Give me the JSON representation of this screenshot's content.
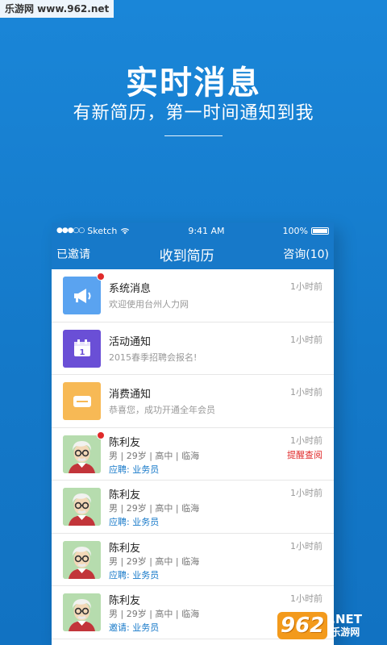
{
  "watermark": {
    "top_left": "乐游网 www.962.net",
    "logo": "962",
    "site": ".NET",
    "site_cn": "乐游网"
  },
  "hero": {
    "title": "实时消息",
    "subtitle": "有新简历，第一时间通知到我"
  },
  "status_bar": {
    "carrier": "Sketch",
    "time": "9:41 AM",
    "battery": "100%"
  },
  "nav": {
    "left": "已邀请",
    "title": "收到简历",
    "right": "咨询(10)"
  },
  "messages": [
    {
      "title": "系统消息",
      "subtitle": "欢迎使用台州人力网",
      "time": "1小时前",
      "icon": "megaphone-icon",
      "color": "#5aa3f0",
      "unread": true
    },
    {
      "title": "活动通知",
      "subtitle": "2015春季招聘会报名!",
      "time": "1小时前",
      "icon": "calendar-icon",
      "color": "#6a4fd6",
      "unread": false
    },
    {
      "title": "消费通知",
      "subtitle": "恭喜您，成功开通全年会员",
      "time": "1小时前",
      "icon": "wallet-icon",
      "color": "#f7b955",
      "unread": false
    }
  ],
  "resumes": [
    {
      "name": "陈利友",
      "info": "男 | 29岁 | 高中 | 临海",
      "job_label": "应聘:",
      "job": "业务员",
      "time": "1小时前",
      "action": "提醒查阅",
      "unread": true
    },
    {
      "name": "陈利友",
      "info": "男 | 29岁 | 高中 | 临海",
      "job_label": "应聘:",
      "job": "业务员",
      "time": "1小时前",
      "action": "",
      "unread": false
    },
    {
      "name": "陈利友",
      "info": "男 | 29岁 | 高中 | 临海",
      "job_label": "应聘:",
      "job": "业务员",
      "time": "1小时前",
      "action": "",
      "unread": false
    },
    {
      "name": "陈利友",
      "info": "男 | 29岁 | 高中 | 临海",
      "job_label": "邀请:",
      "job": "业务员",
      "time": "1小时前",
      "action": "",
      "unread": false
    }
  ]
}
